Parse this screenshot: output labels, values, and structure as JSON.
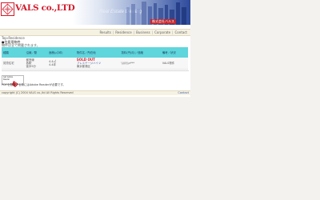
{
  "header": {
    "logo_text": "VALS co.,LTD",
    "tagline": "Real Estate Dealing",
    "brand_jp": "株式会社バルス"
  },
  "nav": [
    "Results",
    "Residence",
    "Business",
    "Corporate",
    "Contact"
  ],
  "breadcrumb": "Top›Residence",
  "section": {
    "heading": "●住居用物件",
    "notice": "物件は全て掲載されます。"
  },
  "table": {
    "headers": [
      "種類",
      "沿線／駅",
      "面積(㎡/坪)",
      "物件名／所在地",
      "賃料(円/月)／価格",
      "備考／状況"
    ],
    "rows": [
      {
        "type": "賃貸住宅",
        "station": "都営線\n各駅\n徒歩5分",
        "area": "4.4㎡\n4.4坪",
        "status_label": "SOLD OUT",
        "name": "プレステージハイツ",
        "address": "東京都港区",
        "price": "\\\\\\\\\\\\\\\\n***",
        "remarks": "VALS物件"
      }
    ]
  },
  "reader": {
    "badge": "Get Adobe Reader",
    "text": "PDFを閲覧する為にはAdobe Readerが必要です。"
  },
  "footer": {
    "copyright": "copyright (C) 2004 VALS co.,ltd All Rights Reserved",
    "contact": "Contact"
  },
  "colors": {
    "logo_red": "#d21a2a",
    "table_header": "#5fd5dc",
    "banner_blue": "#2d4a9c",
    "soldout_red": "#d0202b"
  }
}
